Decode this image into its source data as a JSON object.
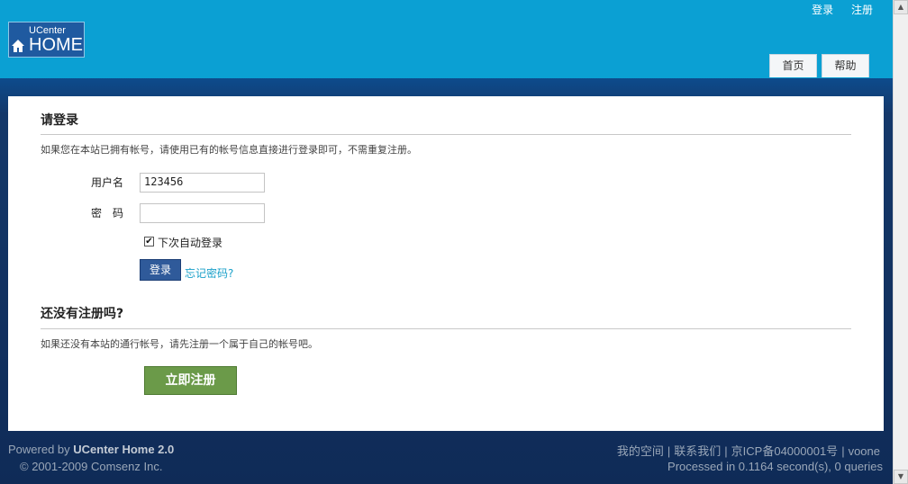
{
  "header": {
    "logo_small": "UCenter",
    "logo_big": "HOME",
    "toplinks": {
      "login": "登录",
      "register": "注册"
    },
    "tabs": [
      {
        "label": "首页"
      },
      {
        "label": "帮助"
      }
    ]
  },
  "login": {
    "title": "请登录",
    "description": "如果您在本站已拥有帐号，请使用已有的帐号信息直接进行登录即可，不需重复注册。",
    "username_label": "用户名",
    "username_value": "123456",
    "password_label": "密　码",
    "password_value": "",
    "remember_checked_glyph": "✔",
    "remember_label": "下次自动登录",
    "submit_label": "登录",
    "forgot_label": "忘记密码?"
  },
  "register": {
    "title": "还没有注册吗?",
    "description": "如果还没有本站的通行帐号，请先注册一个属于自己的帐号吧。",
    "button_label": "立即注册"
  },
  "footer": {
    "powered_prefix": "Powered by ",
    "powered_product": "UCenter Home 2.0",
    "copyright": "© 2001-2009 Comsenz Inc.",
    "links": [
      "我的空间",
      "联系我们",
      "京ICP备04000001号",
      "voone"
    ],
    "separator": "|",
    "processed": "Processed in 0.1164 second(s), 0 queries"
  },
  "colors": {
    "header_bg": "#0ba0d3",
    "login_button": "#2f5a9a",
    "register_button": "#6b9a49",
    "link": "#1aa0c9"
  }
}
